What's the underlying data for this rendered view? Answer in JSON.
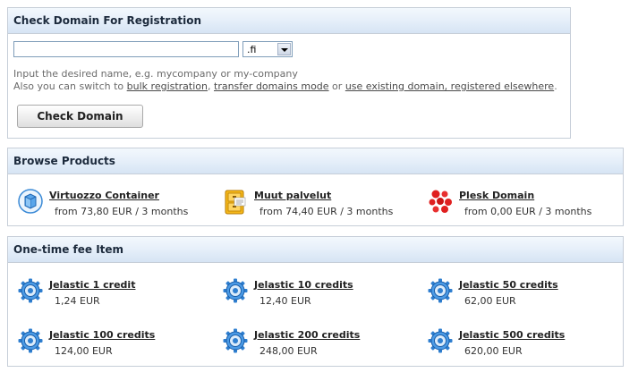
{
  "check_domain": {
    "title": "Check Domain For Registration",
    "domain_input_value": "",
    "tld_selected": ".fi",
    "hint_line1": "Input the desired name, e.g. mycompany or my-company",
    "hint_line2_prefix": "Also you can switch to ",
    "link_bulk": "bulk registration",
    "sep1": ", ",
    "link_transfer": "transfer domains mode",
    "sep2": " or ",
    "link_existing": "use existing domain, registered elsewhere",
    "hint_line2_suffix": ".",
    "button_label": "Check Domain"
  },
  "browse_products": {
    "title": "Browse Products",
    "items": [
      {
        "name": "Virtuozzo Container",
        "price": "from 73,80 EUR / 3 months",
        "icon": "container-cube-icon"
      },
      {
        "name": "Muut palvelut",
        "price": "from 74,40 EUR / 3 months",
        "icon": "file-cabinet-icon"
      },
      {
        "name": "Plesk Domain",
        "price": "from 0,00 EUR / 3 months",
        "icon": "red-dots-icon"
      }
    ]
  },
  "one_time_fee": {
    "title": "One-time fee Item",
    "items": [
      {
        "name": "Jelastic 1 credit",
        "price": "1,24 EUR",
        "icon": "gear-icon"
      },
      {
        "name": "Jelastic 10 credits",
        "price": "12,40 EUR",
        "icon": "gear-icon"
      },
      {
        "name": "Jelastic 50 credits",
        "price": "62,00 EUR",
        "icon": "gear-icon"
      },
      {
        "name": "Jelastic 100 credits",
        "price": "124,00 EUR",
        "icon": "gear-icon"
      },
      {
        "name": "Jelastic 200 credits",
        "price": "248,00 EUR",
        "icon": "gear-icon"
      },
      {
        "name": "Jelastic 500 credits",
        "price": "620,00 EUR",
        "icon": "gear-icon"
      }
    ]
  },
  "colors": {
    "header_gradient_top": "#f3f8fd",
    "header_gradient_bottom": "#d6e4f4",
    "border": "#c6ced8",
    "gear_blue": "#2f7fd0",
    "dots_red": "#e02020"
  }
}
